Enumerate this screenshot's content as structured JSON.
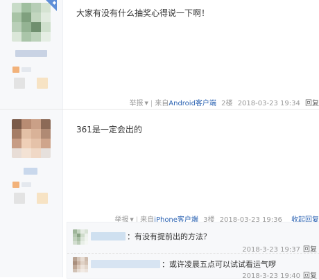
{
  "colors": {
    "link": "#2d64b3",
    "meta": "#999999",
    "badge": "#5f8fd8",
    "author_bg": "#f7f8fa"
  },
  "posts": [
    {
      "content": "大家有没有什么抽奖心得说一下啊！",
      "report": "举报",
      "source_prefix": "来自",
      "client": "Android客户端",
      "floor": "2楼",
      "time": "2018-03-23 19:34",
      "reply": "回复"
    },
    {
      "content": "361是一定会出的",
      "report": "举报",
      "source_prefix": "来自",
      "client": "iPhone客户端",
      "floor": "3楼",
      "time": "2018-03-23 19:36",
      "collapse_reply": "收起回复"
    }
  ],
  "sub_replies": [
    {
      "text": "：有没有提前出的方法？",
      "time": "2018-3-23 19:37",
      "reply": "回复"
    },
    {
      "text": "：或许凌晨五点可以试试看运气啰",
      "time": "2018-3-23 19:40",
      "reply": "回复"
    }
  ]
}
